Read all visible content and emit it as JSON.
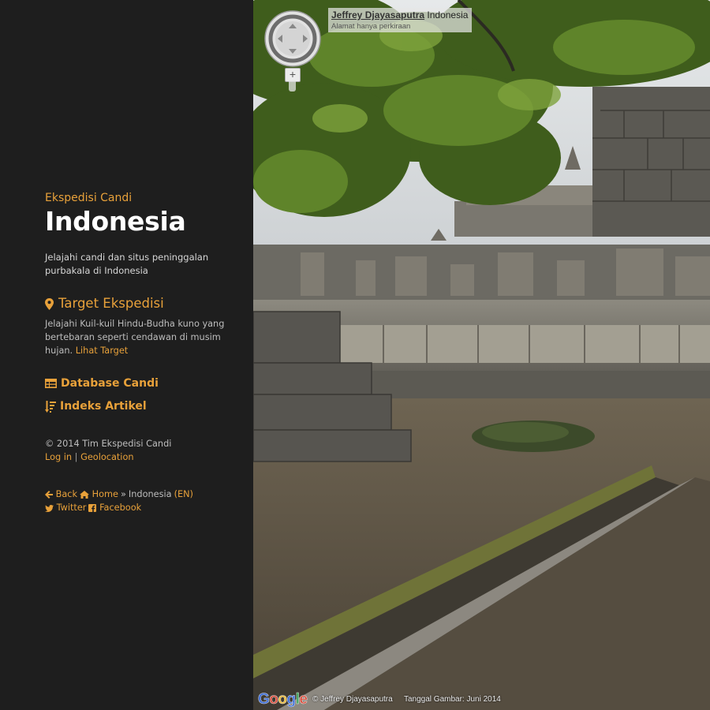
{
  "sidebar": {
    "kicker": "Ekspedisi Candi",
    "title": "Indonesia",
    "intro": "Jelajahi candi dan situs peninggalan purbakala di Indonesia",
    "target_heading": "Target Ekspedisi",
    "target_text": "Jelajahi Kuil-kuil Hindu-Budha kuno yang bertebaran seperti cendawan di musim hujan.",
    "target_link": "Lihat Target",
    "menu": {
      "database": "Database Candi",
      "index": "Indeks Artikel"
    },
    "copyright": "© 2014 Tim Ekspedisi Candi",
    "login": "Log in",
    "separator": "|",
    "geolocation": "Geolocation",
    "nav": {
      "back": "Back",
      "home": "Home",
      "crumb_sep": "»",
      "current": "Indonesia",
      "lang": "(EN)",
      "twitter": "Twitter",
      "facebook": "Facebook"
    }
  },
  "streetview": {
    "author": "Jeffrey Djayasaputra",
    "location": "Indonesia",
    "address_note": "Alamat hanya perkiraan",
    "zoom_in": "+",
    "copyright": "© Jeffrey Djayasaputra",
    "date": "Tanggal Gambar: Juni 2014",
    "logo": [
      "G",
      "o",
      "o",
      "g",
      "l",
      "e"
    ]
  },
  "icons": {
    "target": "map-marker-icon",
    "database": "table-icon",
    "index": "sort-icon",
    "back": "arrow-left-icon",
    "home": "home-icon",
    "twitter": "twitter-icon",
    "facebook": "facebook-icon"
  },
  "colors": {
    "accent": "#e8a13a",
    "sidebar_bg": "#1e1e1e",
    "title": "#ffffff"
  }
}
